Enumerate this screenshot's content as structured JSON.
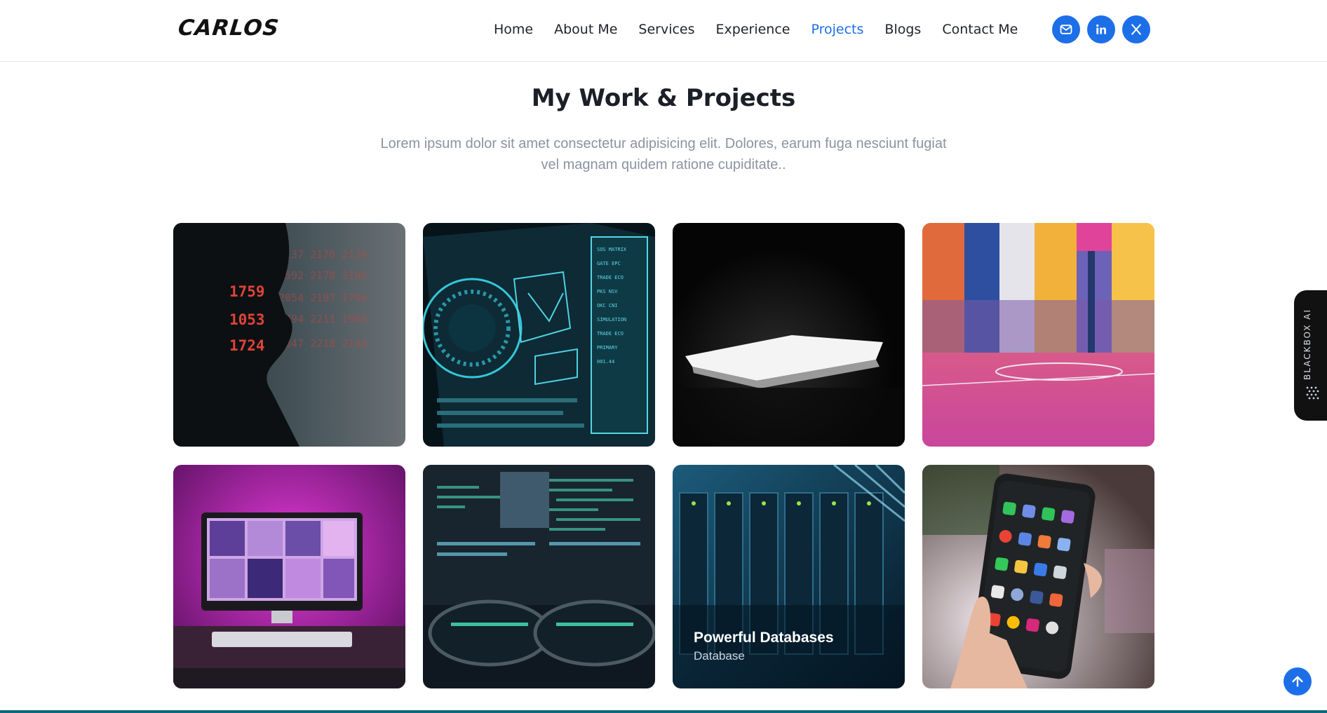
{
  "header": {
    "logo_text": "CARLOS",
    "nav": [
      {
        "label": "Home",
        "active": false
      },
      {
        "label": "About Me",
        "active": false
      },
      {
        "label": "Services",
        "active": false
      },
      {
        "label": "Experience",
        "active": false
      },
      {
        "label": "Projects",
        "active": true
      },
      {
        "label": "Blogs",
        "active": false
      },
      {
        "label": "Contact Me",
        "active": false
      }
    ],
    "socials": [
      "mail-icon",
      "linkedin-icon",
      "x-icon"
    ],
    "accent_color": "#1d6fe8"
  },
  "section": {
    "title": "My Work & Projects",
    "description": "Lorem ipsum dolor sit amet consectetur adipisicing elit. Dolores, earum fuga nesciunt fugiat vel magnam quidem ratione cupiditate.."
  },
  "projects": [
    {
      "image": "hacker-portrait",
      "title": "",
      "category": ""
    },
    {
      "image": "hud-interface",
      "title": "",
      "category": ""
    },
    {
      "image": "dark-laptop",
      "title": "",
      "category": ""
    },
    {
      "image": "basketball-court",
      "title": "",
      "category": ""
    },
    {
      "image": "pink-imac-desk",
      "title": "",
      "category": ""
    },
    {
      "image": "code-glasses",
      "title": "",
      "category": ""
    },
    {
      "image": "server-rack",
      "title": "Powerful Databases",
      "category": "Database"
    },
    {
      "image": "smartphone-hand",
      "title": "",
      "category": ""
    }
  ],
  "side_widget": {
    "label": "BLACKBOX AI"
  },
  "scroll_top": {
    "icon": "arrow-up-icon"
  }
}
